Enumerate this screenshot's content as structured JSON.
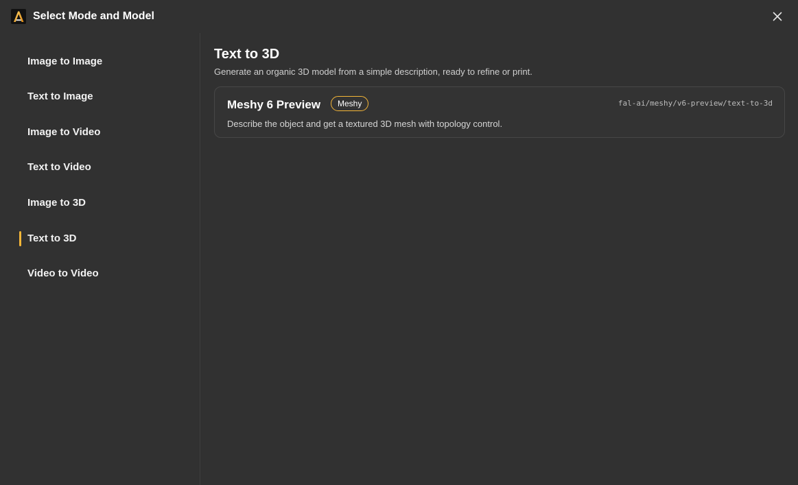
{
  "dialog": {
    "title": "Select Mode and Model",
    "logo_icon": "app-logo-icon",
    "close_icon": "close-icon"
  },
  "sidebar": {
    "items": [
      {
        "label": "Image to Image",
        "active": false
      },
      {
        "label": "Text to Image",
        "active": false
      },
      {
        "label": "Image to Video",
        "active": false
      },
      {
        "label": "Text to Video",
        "active": false
      },
      {
        "label": "Image to 3D",
        "active": false
      },
      {
        "label": "Text to 3D",
        "active": true
      },
      {
        "label": "Video to Video",
        "active": false
      }
    ]
  },
  "main": {
    "title": "Text to 3D",
    "description": "Generate an organic 3D model from a simple description, ready to refine or print.",
    "models": [
      {
        "name": "Meshy 6 Preview",
        "provider": "Meshy",
        "endpoint": "fal-ai/meshy/v6-preview/text-to-3d",
        "description": "Describe the object and get a textured 3D mesh with topology control."
      }
    ]
  },
  "colors": {
    "background": "#313131",
    "accent": "#f5b638",
    "divider": "#3e3e3e",
    "card_border": "#474747"
  }
}
